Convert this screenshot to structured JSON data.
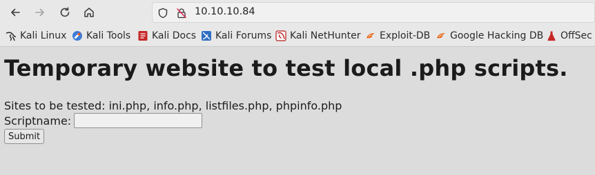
{
  "browser": {
    "url": "10.10.10.84",
    "bookmarks": [
      {
        "label": "Kali Linux",
        "icon": "kali-dragon-icon"
      },
      {
        "label": "Kali Tools",
        "icon": "kali-tools-icon"
      },
      {
        "label": "Kali Docs",
        "icon": "kali-docs-icon"
      },
      {
        "label": "Kali Forums",
        "icon": "kali-forums-icon"
      },
      {
        "label": "Kali NetHunter",
        "icon": "kali-nethunter-icon"
      },
      {
        "label": "Exploit-DB",
        "icon": "exploit-db-icon"
      },
      {
        "label": "Google Hacking DB",
        "icon": "ghdb-icon"
      },
      {
        "label": "OffSec",
        "icon": "offsec-icon"
      }
    ]
  },
  "page": {
    "title": "Temporary website to test local .php scripts.",
    "sites_text": "Sites to be tested: ini.php, info.php, listfiles.php, phpinfo.php",
    "script_label": "Scriptname:",
    "script_value": "",
    "submit_label": "Submit"
  }
}
